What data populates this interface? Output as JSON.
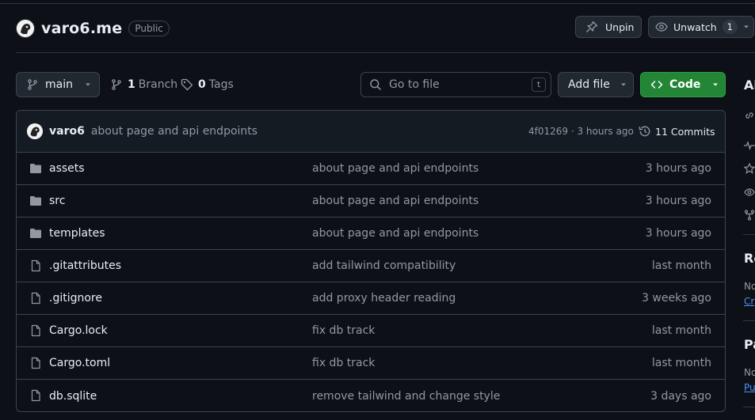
{
  "repo": {
    "name": "varo6.me",
    "visibility": "Public",
    "unpin_label": "Unpin",
    "unwatch_label": "Unwatch",
    "watch_count": "1"
  },
  "toolbar": {
    "branch_name": "main",
    "branch_count": "1",
    "branch_label": "Branch",
    "tag_count": "0",
    "tag_label": "Tags",
    "goto_placeholder": "Go to file",
    "goto_shortcut": "t",
    "add_file_label": "Add file",
    "code_label": "Code"
  },
  "latest_commit": {
    "author": "varo6",
    "message": "about page and api endpoints",
    "meta": "4f01269 · 3 hours ago",
    "commits_label": "11 Commits"
  },
  "files": [
    {
      "type": "folder",
      "name": "assets",
      "message": "about page and api endpoints",
      "time": "3 hours ago"
    },
    {
      "type": "folder",
      "name": "src",
      "message": "about page and api endpoints",
      "time": "3 hours ago"
    },
    {
      "type": "folder",
      "name": "templates",
      "message": "about page and api endpoints",
      "time": "3 hours ago"
    },
    {
      "type": "file",
      "name": ".gitattributes",
      "message": "add tailwind compatibility",
      "time": "last month"
    },
    {
      "type": "file",
      "name": ".gitignore",
      "message": "add proxy header reading",
      "time": "3 weeks ago"
    },
    {
      "type": "file",
      "name": "Cargo.lock",
      "message": "fix db track",
      "time": "last month"
    },
    {
      "type": "file",
      "name": "Cargo.toml",
      "message": "fix db track",
      "time": "last month"
    },
    {
      "type": "file",
      "name": "db.sqlite",
      "message": "remove tailwind and change style",
      "time": "3 days ago"
    }
  ],
  "sidebar": {
    "about_heading": "Ab",
    "releases_heading": "Re",
    "releases_note": "No",
    "releases_link": "Cr",
    "packages_heading": "Pa",
    "packages_note": "No",
    "packages_link": "Pu"
  },
  "colors": {
    "background": "#0d1117",
    "accent_green": "#238636",
    "link_blue": "#4493f8"
  }
}
